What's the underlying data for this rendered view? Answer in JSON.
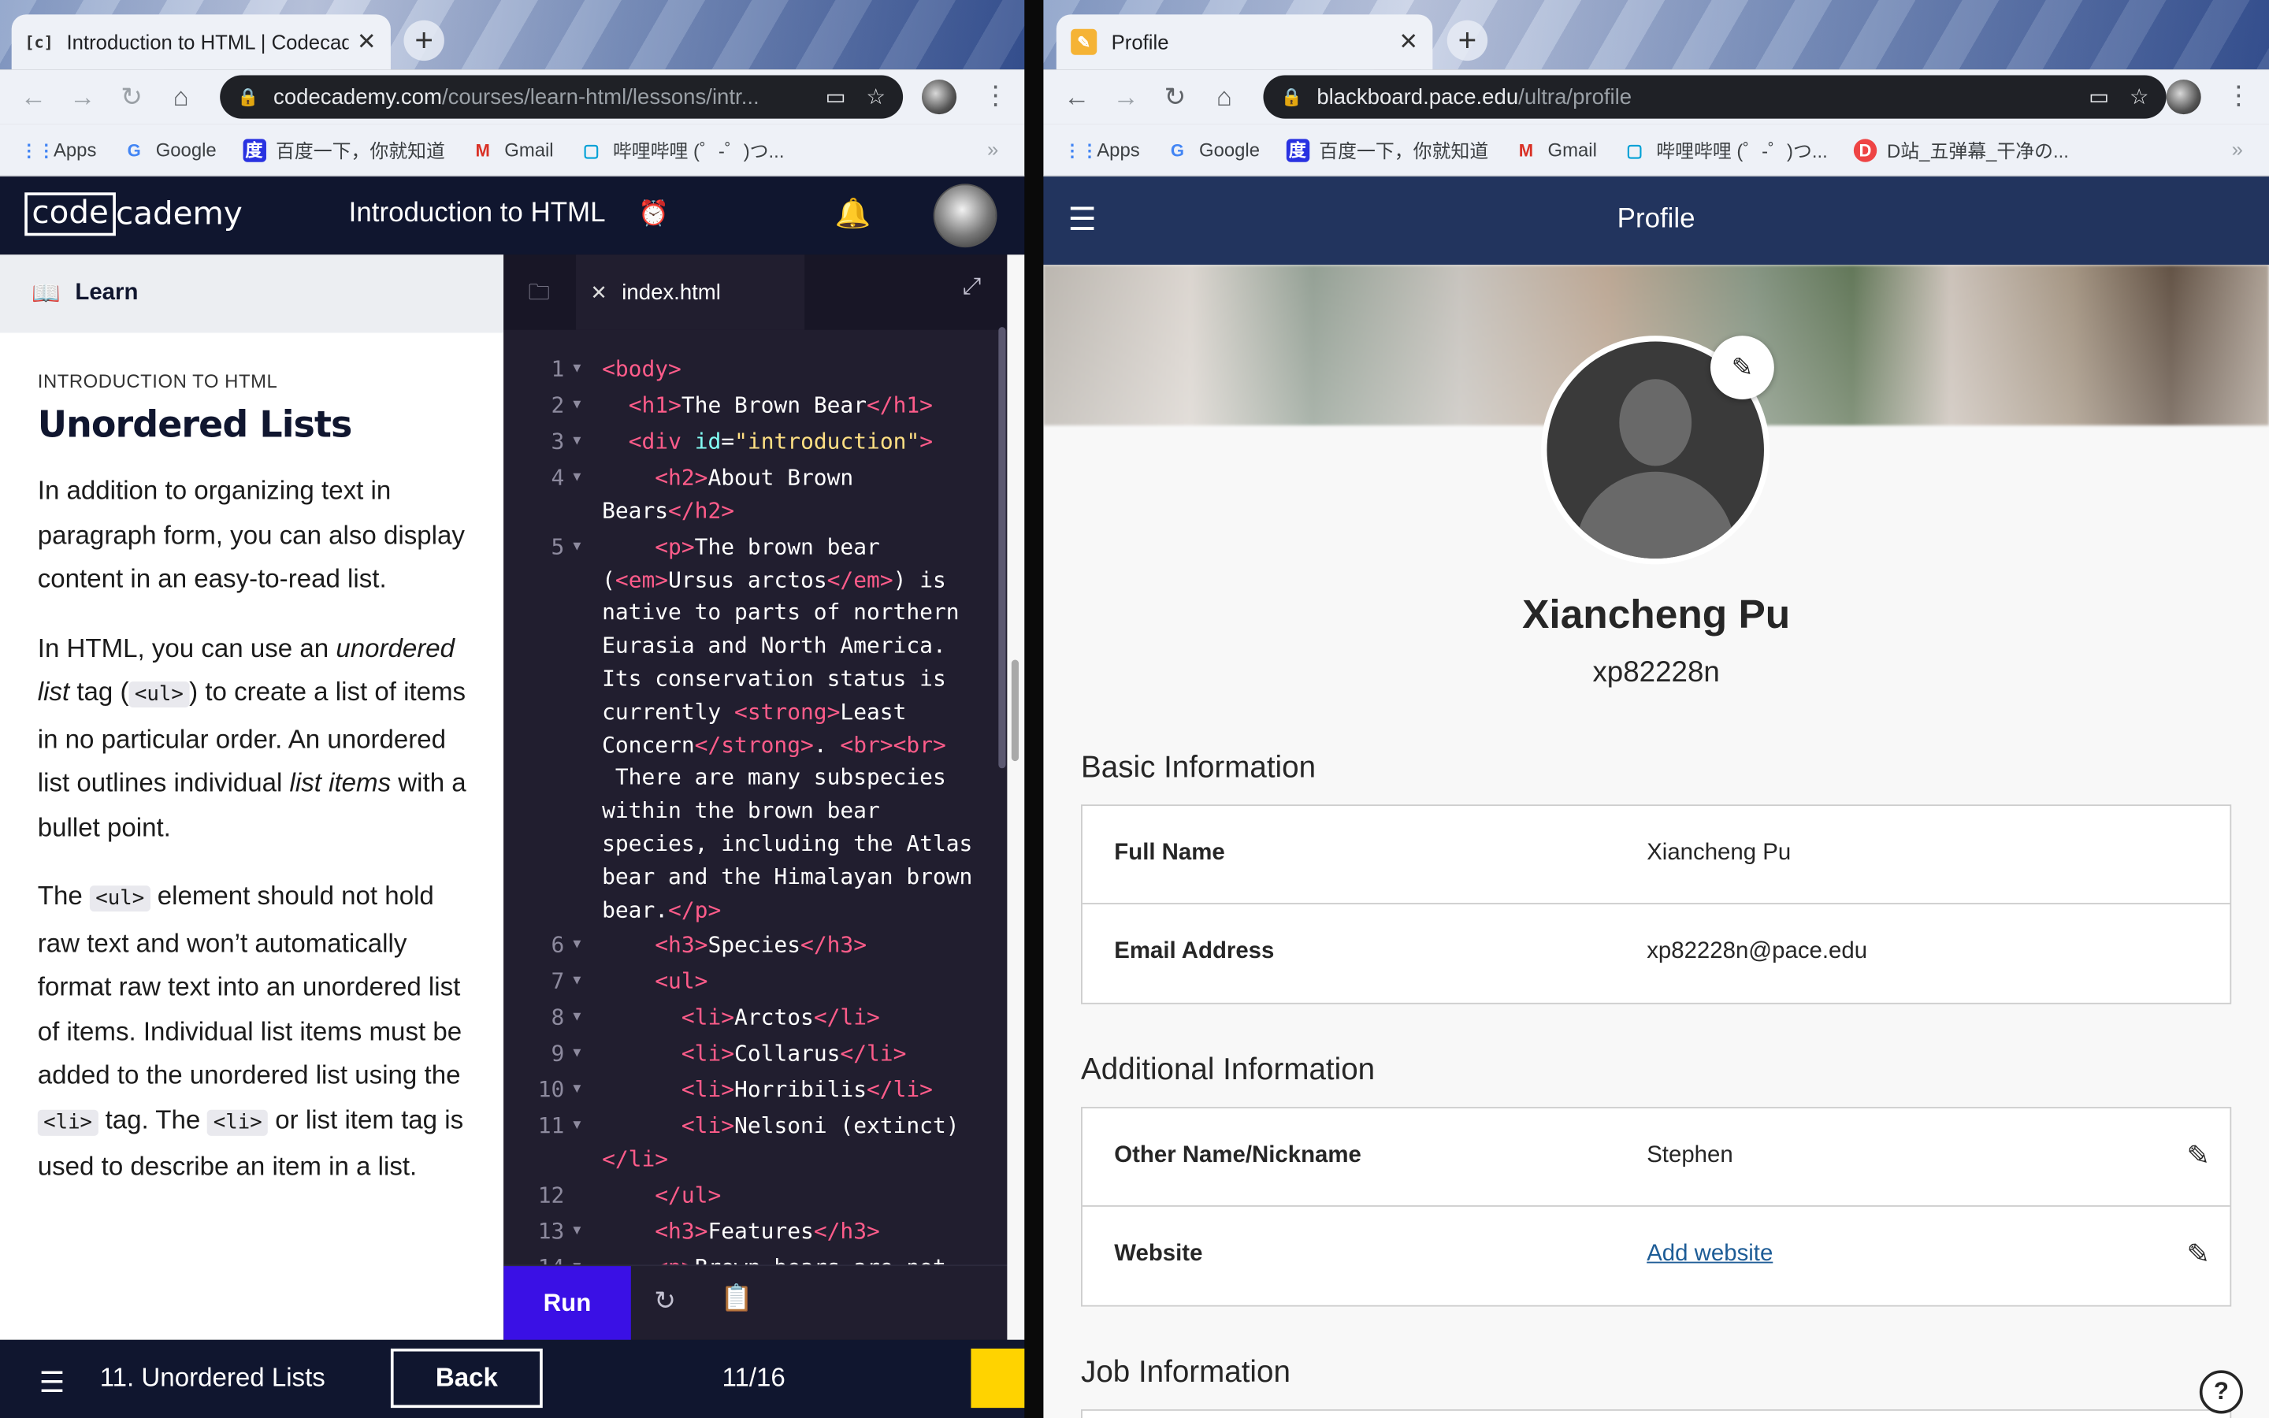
{
  "left_browser": {
    "tab": {
      "title": "Introduction to HTML | Codecad",
      "favicon": "[c]"
    },
    "url": {
      "host": "codecademy.com",
      "path": "/courses/learn-html/lessons/intr..."
    },
    "bookmarks": [
      {
        "icon": "apps-icon",
        "label": "Apps"
      },
      {
        "icon": "google-icon",
        "label": "Google"
      },
      {
        "icon": "baidu-icon",
        "label": "百度一下，你就知道"
      },
      {
        "icon": "gmail-icon",
        "label": "Gmail"
      },
      {
        "icon": "bilibili-icon",
        "label": "哔哩哔哩 (゜-゜)つ..."
      }
    ]
  },
  "right_browser": {
    "tab": {
      "title": "Profile"
    },
    "url": {
      "host": "blackboard.pace.edu",
      "path": "/ultra/profile"
    },
    "bookmarks": [
      {
        "icon": "apps-icon",
        "label": "Apps"
      },
      {
        "icon": "google-icon",
        "label": "Google"
      },
      {
        "icon": "baidu-icon",
        "label": "百度一下，你就知道"
      },
      {
        "icon": "gmail-icon",
        "label": "Gmail"
      },
      {
        "icon": "bilibili-icon",
        "label": "哔哩哔哩 (゜-゜)つ..."
      },
      {
        "icon": "d-station-icon",
        "label": "D站_五弹幕_干净の..."
      }
    ]
  },
  "codecademy": {
    "logo_left": "code",
    "logo_right": "cademy",
    "course_title": "Introduction to HTML",
    "learn_tab": "Learn",
    "kicker": "INTRODUCTION TO HTML",
    "heading": "Unordered Lists",
    "p1": "In addition to organizing text in paragraph form, you can also display content in an easy-to-read list.",
    "p2": {
      "a": "In HTML, you can use an ",
      "em1": "unordered list",
      "b": " tag (",
      "code1": "<ul>",
      "c": ") to create a list of items in no particular order. An unordered list outlines individual ",
      "em2": "list items",
      "d": " with a bullet point."
    },
    "p3": {
      "a": "The ",
      "code1": "<ul>",
      "b": " element should not hold raw text and won’t automatically format raw text into an unordered list of items. Individual list items must be added to the unordered list using the ",
      "code2": "<li>",
      "c": " tag. The ",
      "code3": "<li>",
      "d": " or list item tag is used to describe an item in a list."
    },
    "editor_tab": "index.html",
    "run_label": "Run",
    "footer": {
      "lesson": "11. Unordered Lists",
      "back_label": "Back",
      "progress": "11/16"
    }
  },
  "blackboard": {
    "header_title": "Profile",
    "name": "Xiancheng Pu",
    "username": "xp82228n",
    "basic_section": "Basic Information",
    "basic": [
      {
        "label": "Full Name",
        "value": "Xiancheng Pu"
      },
      {
        "label": "Email Address",
        "value": "xp82228n@pace.edu"
      }
    ],
    "additional_section": "Additional Information",
    "additional": [
      {
        "label": "Other Name/Nickname",
        "value": "Stephen"
      },
      {
        "label": "Website",
        "value": "Add website"
      }
    ],
    "job_section": "Job Information",
    "help": "?"
  }
}
